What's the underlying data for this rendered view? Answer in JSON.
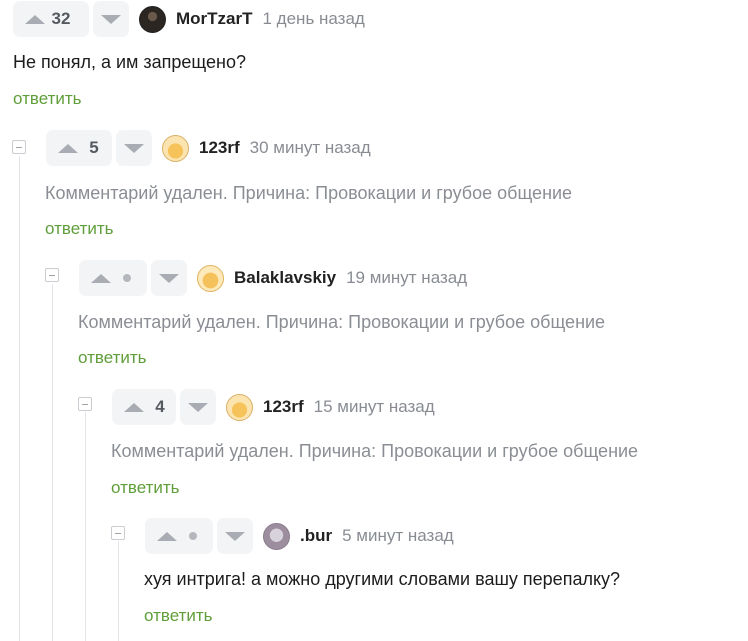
{
  "comments": [
    {
      "votes": "32",
      "user": "MorTzarT",
      "time": "1 день назад",
      "text": "Не понял, а им запрещено?",
      "reply": "ответить",
      "avatar": "user-avatar-dark"
    },
    {
      "votes": "5",
      "user": "123rf",
      "time": "30 минут назад",
      "text": "Комментарий удален. Причина: Провокации и грубое общение",
      "reply": "ответить",
      "avatar": "user-avatar-cat"
    },
    {
      "votes": "",
      "user": "Balaklavskiy",
      "time": "19 минут назад",
      "text": "Комментарий удален. Причина: Провокации и грубое общение",
      "reply": "ответить",
      "avatar": "user-avatar-cat"
    },
    {
      "votes": "4",
      "user": "123rf",
      "time": "15 минут назад",
      "text": "Комментарий удален. Причина: Провокации и грубое общение",
      "reply": "ответить",
      "avatar": "user-avatar-cat"
    },
    {
      "votes": "",
      "user": ".bur",
      "time": "5 минут назад",
      "text": "хуя интрига! а можно другими словами вашу перепалку?",
      "reply": "ответить",
      "avatar": "user-avatar-bur"
    }
  ],
  "colors": {
    "reply_link": "#5f9e3a",
    "deleted_text": "#8a8e94",
    "rating_bg": "#f3f4f5"
  }
}
